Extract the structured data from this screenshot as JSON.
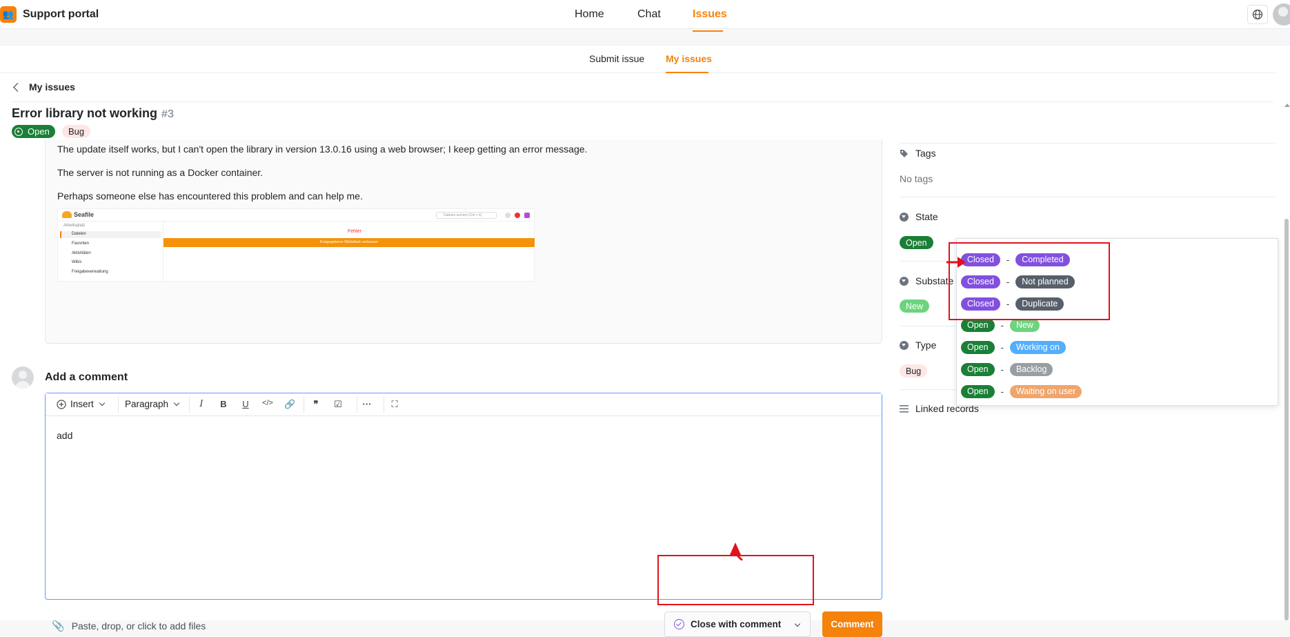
{
  "brand": {
    "name": "Support portal",
    "color": "#f5820b"
  },
  "top_nav": {
    "items": [
      "Home",
      "Chat",
      "Issues"
    ],
    "active": "Issues"
  },
  "sub_tabs": {
    "items": [
      "Submit issue",
      "My issues"
    ],
    "active": "My issues"
  },
  "back_link": "My issues",
  "issue": {
    "title": "Error library not working",
    "number": "#3",
    "state_badge": "Open",
    "type_badge": "Bug",
    "description": [
      "The update itself works, but I can't open the library in version 13.0.16 using a web browser; I keep getting an error message.",
      "The server is not running as a Docker container.",
      "Perhaps someone else has encountered this problem and can help me."
    ],
    "embedded_screenshot": {
      "logo": "Seafile",
      "search_placeholder": "Dateien suchen (Ctrl + k)",
      "sidebar_header": "Arbeitsplatz",
      "sidebar_items": [
        "Dateien",
        "Favoriten",
        "Aktivitäten",
        "Wikis",
        "Freigabeverwaltung"
      ],
      "error_title": "Fehler",
      "error_bar": "Freigegebene Bibliothek verlassen"
    }
  },
  "comment": {
    "heading": "Add a comment",
    "toolbar": {
      "insert": "Insert",
      "paragraph": "Paragraph"
    },
    "editor_text": "add",
    "attach_hint": "Paste, drop, or click to add files",
    "close_button": "Close with comment",
    "comment_button": "Comment"
  },
  "sidebar": {
    "tags_label": "Tags",
    "tags_value": "No tags",
    "state_label": "State",
    "state_value": "Open",
    "substate_label": "Substate",
    "substate_value": "New",
    "type_label": "Type",
    "type_value": "Bug",
    "linked_label": "Linked records"
  },
  "state_dropdown": {
    "options": [
      {
        "state": "Closed",
        "substate": "Completed",
        "state_color": "#8250df",
        "sub_color": "#8250df",
        "sub_text_color": "#ffffff"
      },
      {
        "state": "Closed",
        "substate": "Not planned",
        "state_color": "#8250df",
        "sub_color": "#57606a",
        "sub_text_color": "#ffffff"
      },
      {
        "state": "Closed",
        "substate": "Duplicate",
        "state_color": "#8250df",
        "sub_color": "#57606a",
        "sub_text_color": "#ffffff"
      },
      {
        "state": "Open",
        "substate": "New",
        "state_color": "#1a7f37",
        "sub_color": "#6cd47e",
        "sub_text_color": "#ffffff"
      },
      {
        "state": "Open",
        "substate": "Working on",
        "state_color": "#1a7f37",
        "sub_color": "#54aeff",
        "sub_text_color": "#ffffff"
      },
      {
        "state": "Open",
        "substate": "Backlog",
        "state_color": "#1a7f37",
        "sub_color": "#9a9ea3",
        "sub_text_color": "#ffffff"
      },
      {
        "state": "Open",
        "substate": "Waiting on user",
        "state_color": "#1a7f37",
        "sub_color": "#f0a56b",
        "sub_text_color": "#ffffff"
      }
    ],
    "separator": "-"
  },
  "colors": {
    "accent": "#f5820b",
    "open": "#1a7f37",
    "closed": "#8250df",
    "annotation": "#e3101e"
  }
}
